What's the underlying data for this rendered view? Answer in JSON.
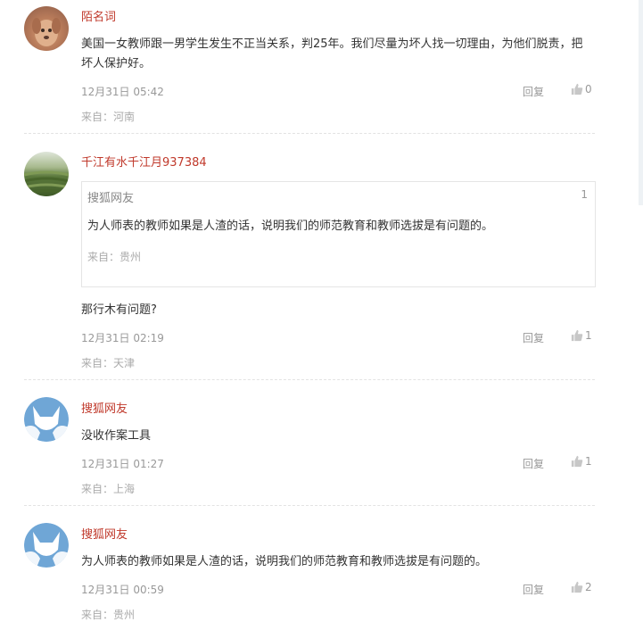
{
  "ui": {
    "reply_label": "回复"
  },
  "comments": [
    {
      "username": "陌名词",
      "text": "美国一女教师跟一男学生发生不正当关系，判25年。我们尽量为坏人找一切理由，为他们脱责，把坏人保护好。",
      "time": "12月31日 05:42",
      "likes": "0",
      "location": "来自：河南"
    },
    {
      "username": "千江有水千江月937384",
      "quote": {
        "username": "搜狐网友",
        "floor": "1",
        "text": "为人师表的教师如果是人渣的话，说明我们的师范教育和教师选拔是有问题的。",
        "location": "来自：贵州"
      },
      "text": "那行木有问题?",
      "time": "12月31日 02:19",
      "likes": "1",
      "location": "来自：天津"
    },
    {
      "username": "搜狐网友",
      "text": "没收作案工具",
      "time": "12月31日 01:27",
      "likes": "1",
      "location": "来自：上海"
    },
    {
      "username": "搜狐网友",
      "text": "为人师表的教师如果是人渣的话，说明我们的师范教育和教师选拔是有问题的。",
      "time": "12月31日 00:59",
      "likes": "2",
      "location": "来自：贵州"
    }
  ]
}
